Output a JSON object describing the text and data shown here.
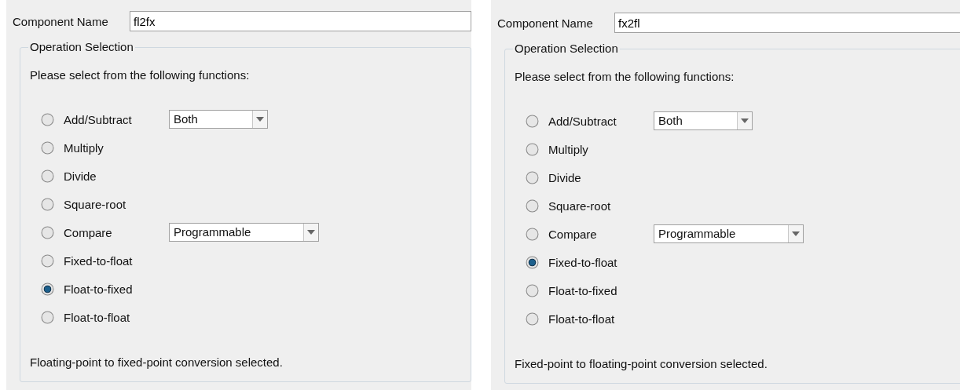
{
  "panels": [
    {
      "component_name": {
        "label": "Component Name",
        "value": "fl2fx"
      },
      "operation_selection": {
        "title": "Operation Selection",
        "prompt": "Please select from the following functions:",
        "operations": [
          {
            "label": "Add/Subtract",
            "selected": false,
            "dropdown": "Both",
            "kind": "short"
          },
          {
            "label": "Multiply",
            "selected": false
          },
          {
            "label": "Divide",
            "selected": false
          },
          {
            "label": "Square-root",
            "selected": false
          },
          {
            "label": "Compare",
            "selected": false,
            "dropdown": "Programmable",
            "kind": "long"
          },
          {
            "label": "Fixed-to-float",
            "selected": false
          },
          {
            "label": "Float-to-fixed",
            "selected": true
          },
          {
            "label": "Float-to-float",
            "selected": false
          }
        ],
        "status": "Floating-point to fixed-point conversion selected."
      }
    },
    {
      "component_name": {
        "label": "Component Name",
        "value": "fx2fl"
      },
      "operation_selection": {
        "title": "Operation Selection",
        "prompt": "Please select from the following functions:",
        "operations": [
          {
            "label": "Add/Subtract",
            "selected": false,
            "dropdown": "Both",
            "kind": "short"
          },
          {
            "label": "Multiply",
            "selected": false
          },
          {
            "label": "Divide",
            "selected": false
          },
          {
            "label": "Square-root",
            "selected": false
          },
          {
            "label": "Compare",
            "selected": false,
            "dropdown": "Programmable",
            "kind": "long"
          },
          {
            "label": "Fixed-to-float",
            "selected": true
          },
          {
            "label": "Float-to-fixed",
            "selected": false
          },
          {
            "label": "Float-to-float",
            "selected": false
          }
        ],
        "status": "Fixed-point to floating-point conversion selected."
      }
    }
  ]
}
